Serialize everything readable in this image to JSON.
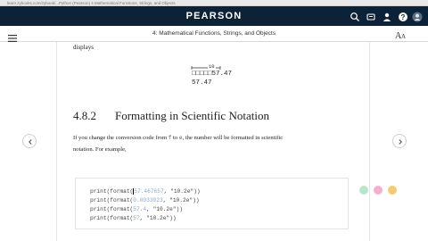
{
  "browser": {
    "url": "learn.zybooks.com/zybook/...Python (Pearson) 4 Mathematical Functions, Strings, and Objects"
  },
  "header": {
    "brand": "PEARSON",
    "chapter_title": "4: Mathematical Functions, Strings, and Objects"
  },
  "content": {
    "intro_word": "displays",
    "figure": {
      "width_label": "10",
      "line1": "□□□□□57.47",
      "line2": "57.47"
    },
    "section": {
      "number": "4.8.2",
      "title": "Formatting in Scientific Notation"
    },
    "paragraph": {
      "part1": "If you change the conversion code from",
      "code1": "f",
      "part2": "to",
      "code2": "e",
      "part3": ", the number will be formatted in scientific",
      "line2": "notation. For example,"
    },
    "code_lines": [
      {
        "prefix": "print(format(",
        "arg": "57.467657",
        "suffix": ", \"10.2e\"))"
      },
      {
        "prefix": "print(format(",
        "arg": "0.0033923",
        "suffix": ", \"10.2e\"))"
      },
      {
        "prefix": "print(format(",
        "arg": "57.4",
        "suffix": ", \"10.2e\"))"
      },
      {
        "prefix": "print(format(",
        "arg": "57",
        "suffix": ", \"10.2e\"))"
      }
    ]
  },
  "colors": {
    "header_bg": "#0b2237",
    "dot_green": "#b7e6cf",
    "dot_pink": "#f3b0cc",
    "dot_yellow": "#f7ca6e"
  },
  "icons": [
    "menu-icon",
    "search-icon",
    "notifications-icon",
    "user-icon",
    "help-icon",
    "font-size-icon",
    "prev-page-icon",
    "next-page-icon"
  ]
}
